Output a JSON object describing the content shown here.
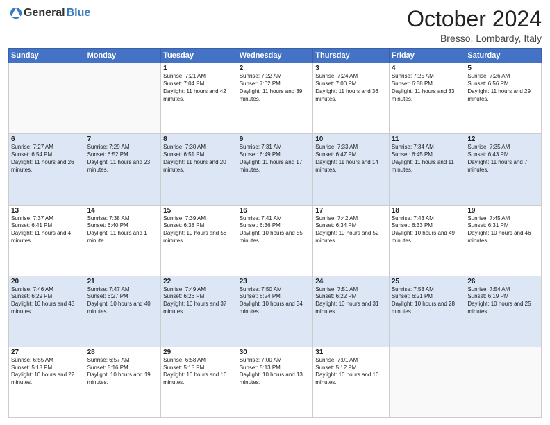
{
  "header": {
    "logo": {
      "general": "General",
      "blue": "Blue"
    },
    "title": "October 2024",
    "location": "Bresso, Lombardy, Italy"
  },
  "days_of_week": [
    "Sunday",
    "Monday",
    "Tuesday",
    "Wednesday",
    "Thursday",
    "Friday",
    "Saturday"
  ],
  "weeks": [
    [
      {
        "day": "",
        "sunrise": "",
        "sunset": "",
        "daylight": ""
      },
      {
        "day": "",
        "sunrise": "",
        "sunset": "",
        "daylight": ""
      },
      {
        "day": "1",
        "sunrise": "Sunrise: 7:21 AM",
        "sunset": "Sunset: 7:04 PM",
        "daylight": "Daylight: 11 hours and 42 minutes."
      },
      {
        "day": "2",
        "sunrise": "Sunrise: 7:22 AM",
        "sunset": "Sunset: 7:02 PM",
        "daylight": "Daylight: 11 hours and 39 minutes."
      },
      {
        "day": "3",
        "sunrise": "Sunrise: 7:24 AM",
        "sunset": "Sunset: 7:00 PM",
        "daylight": "Daylight: 11 hours and 36 minutes."
      },
      {
        "day": "4",
        "sunrise": "Sunrise: 7:25 AM",
        "sunset": "Sunset: 6:58 PM",
        "daylight": "Daylight: 11 hours and 33 minutes."
      },
      {
        "day": "5",
        "sunrise": "Sunrise: 7:26 AM",
        "sunset": "Sunset: 6:56 PM",
        "daylight": "Daylight: 11 hours and 29 minutes."
      }
    ],
    [
      {
        "day": "6",
        "sunrise": "Sunrise: 7:27 AM",
        "sunset": "Sunset: 6:54 PM",
        "daylight": "Daylight: 11 hours and 26 minutes."
      },
      {
        "day": "7",
        "sunrise": "Sunrise: 7:29 AM",
        "sunset": "Sunset: 6:52 PM",
        "daylight": "Daylight: 11 hours and 23 minutes."
      },
      {
        "day": "8",
        "sunrise": "Sunrise: 7:30 AM",
        "sunset": "Sunset: 6:51 PM",
        "daylight": "Daylight: 11 hours and 20 minutes."
      },
      {
        "day": "9",
        "sunrise": "Sunrise: 7:31 AM",
        "sunset": "Sunset: 6:49 PM",
        "daylight": "Daylight: 11 hours and 17 minutes."
      },
      {
        "day": "10",
        "sunrise": "Sunrise: 7:33 AM",
        "sunset": "Sunset: 6:47 PM",
        "daylight": "Daylight: 11 hours and 14 minutes."
      },
      {
        "day": "11",
        "sunrise": "Sunrise: 7:34 AM",
        "sunset": "Sunset: 6:45 PM",
        "daylight": "Daylight: 11 hours and 11 minutes."
      },
      {
        "day": "12",
        "sunrise": "Sunrise: 7:35 AM",
        "sunset": "Sunset: 6:43 PM",
        "daylight": "Daylight: 11 hours and 7 minutes."
      }
    ],
    [
      {
        "day": "13",
        "sunrise": "Sunrise: 7:37 AM",
        "sunset": "Sunset: 6:41 PM",
        "daylight": "Daylight: 11 hours and 4 minutes."
      },
      {
        "day": "14",
        "sunrise": "Sunrise: 7:38 AM",
        "sunset": "Sunset: 6:40 PM",
        "daylight": "Daylight: 11 hours and 1 minute."
      },
      {
        "day": "15",
        "sunrise": "Sunrise: 7:39 AM",
        "sunset": "Sunset: 6:38 PM",
        "daylight": "Daylight: 10 hours and 58 minutes."
      },
      {
        "day": "16",
        "sunrise": "Sunrise: 7:41 AM",
        "sunset": "Sunset: 6:36 PM",
        "daylight": "Daylight: 10 hours and 55 minutes."
      },
      {
        "day": "17",
        "sunrise": "Sunrise: 7:42 AM",
        "sunset": "Sunset: 6:34 PM",
        "daylight": "Daylight: 10 hours and 52 minutes."
      },
      {
        "day": "18",
        "sunrise": "Sunrise: 7:43 AM",
        "sunset": "Sunset: 6:33 PM",
        "daylight": "Daylight: 10 hours and 49 minutes."
      },
      {
        "day": "19",
        "sunrise": "Sunrise: 7:45 AM",
        "sunset": "Sunset: 6:31 PM",
        "daylight": "Daylight: 10 hours and 46 minutes."
      }
    ],
    [
      {
        "day": "20",
        "sunrise": "Sunrise: 7:46 AM",
        "sunset": "Sunset: 6:29 PM",
        "daylight": "Daylight: 10 hours and 43 minutes."
      },
      {
        "day": "21",
        "sunrise": "Sunrise: 7:47 AM",
        "sunset": "Sunset: 6:27 PM",
        "daylight": "Daylight: 10 hours and 40 minutes."
      },
      {
        "day": "22",
        "sunrise": "Sunrise: 7:49 AM",
        "sunset": "Sunset: 6:26 PM",
        "daylight": "Daylight: 10 hours and 37 minutes."
      },
      {
        "day": "23",
        "sunrise": "Sunrise: 7:50 AM",
        "sunset": "Sunset: 6:24 PM",
        "daylight": "Daylight: 10 hours and 34 minutes."
      },
      {
        "day": "24",
        "sunrise": "Sunrise: 7:51 AM",
        "sunset": "Sunset: 6:22 PM",
        "daylight": "Daylight: 10 hours and 31 minutes."
      },
      {
        "day": "25",
        "sunrise": "Sunrise: 7:53 AM",
        "sunset": "Sunset: 6:21 PM",
        "daylight": "Daylight: 10 hours and 28 minutes."
      },
      {
        "day": "26",
        "sunrise": "Sunrise: 7:54 AM",
        "sunset": "Sunset: 6:19 PM",
        "daylight": "Daylight: 10 hours and 25 minutes."
      }
    ],
    [
      {
        "day": "27",
        "sunrise": "Sunrise: 6:55 AM",
        "sunset": "Sunset: 5:18 PM",
        "daylight": "Daylight: 10 hours and 22 minutes."
      },
      {
        "day": "28",
        "sunrise": "Sunrise: 6:57 AM",
        "sunset": "Sunset: 5:16 PM",
        "daylight": "Daylight: 10 hours and 19 minutes."
      },
      {
        "day": "29",
        "sunrise": "Sunrise: 6:58 AM",
        "sunset": "Sunset: 5:15 PM",
        "daylight": "Daylight: 10 hours and 16 minutes."
      },
      {
        "day": "30",
        "sunrise": "Sunrise: 7:00 AM",
        "sunset": "Sunset: 5:13 PM",
        "daylight": "Daylight: 10 hours and 13 minutes."
      },
      {
        "day": "31",
        "sunrise": "Sunrise: 7:01 AM",
        "sunset": "Sunset: 5:12 PM",
        "daylight": "Daylight: 10 hours and 10 minutes."
      },
      {
        "day": "",
        "sunrise": "",
        "sunset": "",
        "daylight": ""
      },
      {
        "day": "",
        "sunrise": "",
        "sunset": "",
        "daylight": ""
      }
    ]
  ]
}
